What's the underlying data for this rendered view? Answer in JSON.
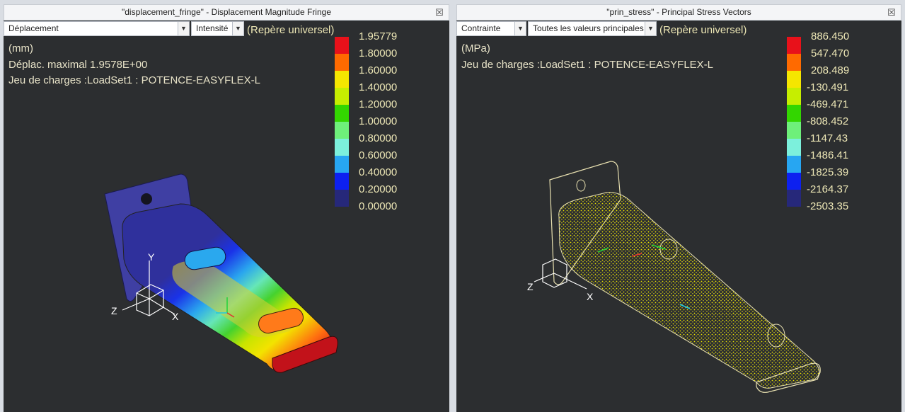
{
  "left": {
    "title": "\"displacement_fringe\" - Displacement Magnitude Fringe",
    "close": "☒",
    "dropdown1": "Déplacement",
    "dropdown2": "Intensité",
    "frame": "(Repère universel)",
    "units": "(mm)",
    "max_line": "Déplac. maximal  1.9578E+00",
    "load_line": "Jeu de charges :LoadSet1 :  POTENCE-EASYFLEX-L",
    "legend_values": [
      "1.95779",
      "1.80000",
      "1.60000",
      "1.40000",
      "1.20000",
      "1.00000",
      "0.80000",
      "0.60000",
      "0.40000",
      "0.20000",
      "0.00000"
    ]
  },
  "right": {
    "title": "\"prin_stress\" - Principal Stress Vectors",
    "close": "☒",
    "dropdown1": "Contrainte",
    "dropdown2": "Toutes les valeurs principales",
    "frame": "(Repère universel)",
    "units": "(MPa)",
    "load_line": "Jeu de charges :LoadSet1 :  POTENCE-EASYFLEX-L",
    "legend_values": [
      "886.450",
      "547.470",
      "208.489",
      "-130.491",
      "-469.471",
      "-808.452",
      "-1147.43",
      "-1486.41",
      "-1825.39",
      "-2164.37",
      "-2503.35"
    ]
  },
  "legend_colors": [
    "#e8111a",
    "#ff6a00",
    "#f5e600",
    "#c6ee00",
    "#33d600",
    "#6ef07a",
    "#7cf0dc",
    "#27a6f2",
    "#0d20f0",
    "#26287a"
  ],
  "axis_labels": {
    "x": "X",
    "y": "Y",
    "z": "Z"
  }
}
